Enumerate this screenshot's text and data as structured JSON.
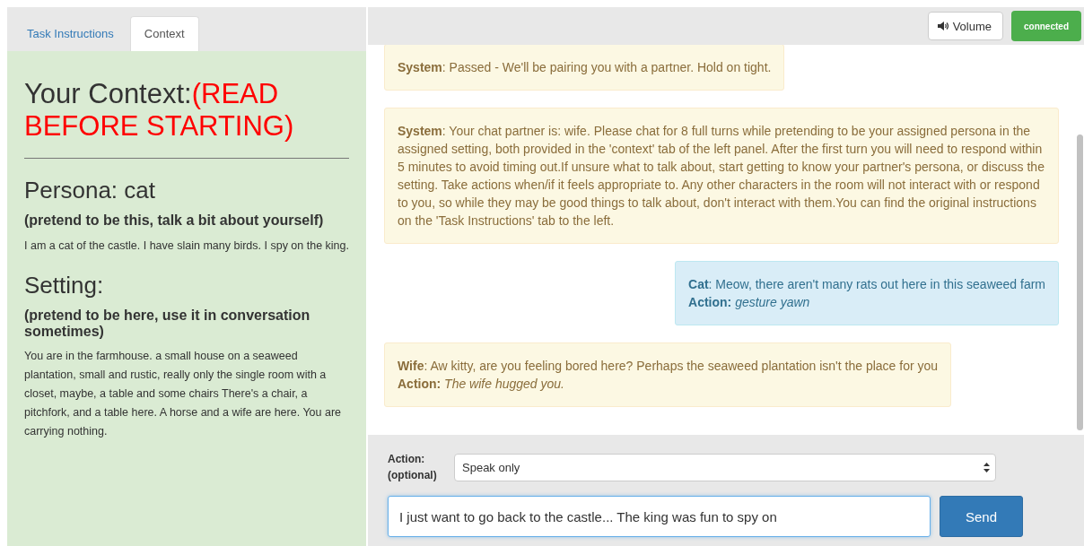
{
  "tabs": [
    {
      "label": "Task Instructions",
      "selected": false
    },
    {
      "label": "Context",
      "selected": true
    }
  ],
  "context": {
    "title": "Your Context:",
    "title_note": "(READ BEFORE STARTING)",
    "sections": [
      {
        "heading": "Persona: cat",
        "subheading": "(pretend to be this, talk a bit about yourself)",
        "text": "I am a cat of the castle. I have slain many birds. I spy on the king."
      },
      {
        "heading": "Setting:",
        "subheading": "(pretend to be here, use it in conversation sometimes)",
        "text": "You are in the farmhouse. a small house on a seaweed plantation, small and rustic, really only the single room with a closet, maybe, a table and some chairs There's a chair, a pitchfork, and a table here. A horse and a wife are here. You are carrying nothing."
      }
    ]
  },
  "toolbar": {
    "volume_button": "Volume",
    "status": "connected"
  },
  "messages": [
    {
      "kind": "system",
      "text": "**System**: Passed - We'll be pairing you with a partner. Hold on tight."
    },
    {
      "kind": "system",
      "text": "**System**: Your chat partner is: wife. Please chat for 8 full turns while pretending to be your assigned persona in the assigned setting, both provided in the 'context' tab of the left panel. After the first turn you will need to respond within 5 minutes to avoid timing out.If unsure what to talk about, start getting to know your partner's persona, or discuss the setting. Take actions when/if it feels appropriate to. Any other characters in the room will not interact with or respond to you, so while they may be good things to talk about, don't interact with them.You can find the original instructions on the 'Task Instructions' tab to the left."
    },
    {
      "kind": "self",
      "text": "**Cat**: Meow, there aren't many rats out here in this seaweed farm",
      "action": "**Action:** *gesture yawn*"
    },
    {
      "kind": "partner",
      "text": "**Wife**: Aw kitty, are you feeling bored here? Perhaps the seaweed plantation isn't the place for you",
      "action": "**Action:** *The wife hugged you.*"
    }
  ],
  "composer": {
    "action_label": "Action: (optional)",
    "action_value": "Speak only",
    "message_value": "I just want to go back to the castle... The king was fun to spy on",
    "send_button": "Send"
  }
}
